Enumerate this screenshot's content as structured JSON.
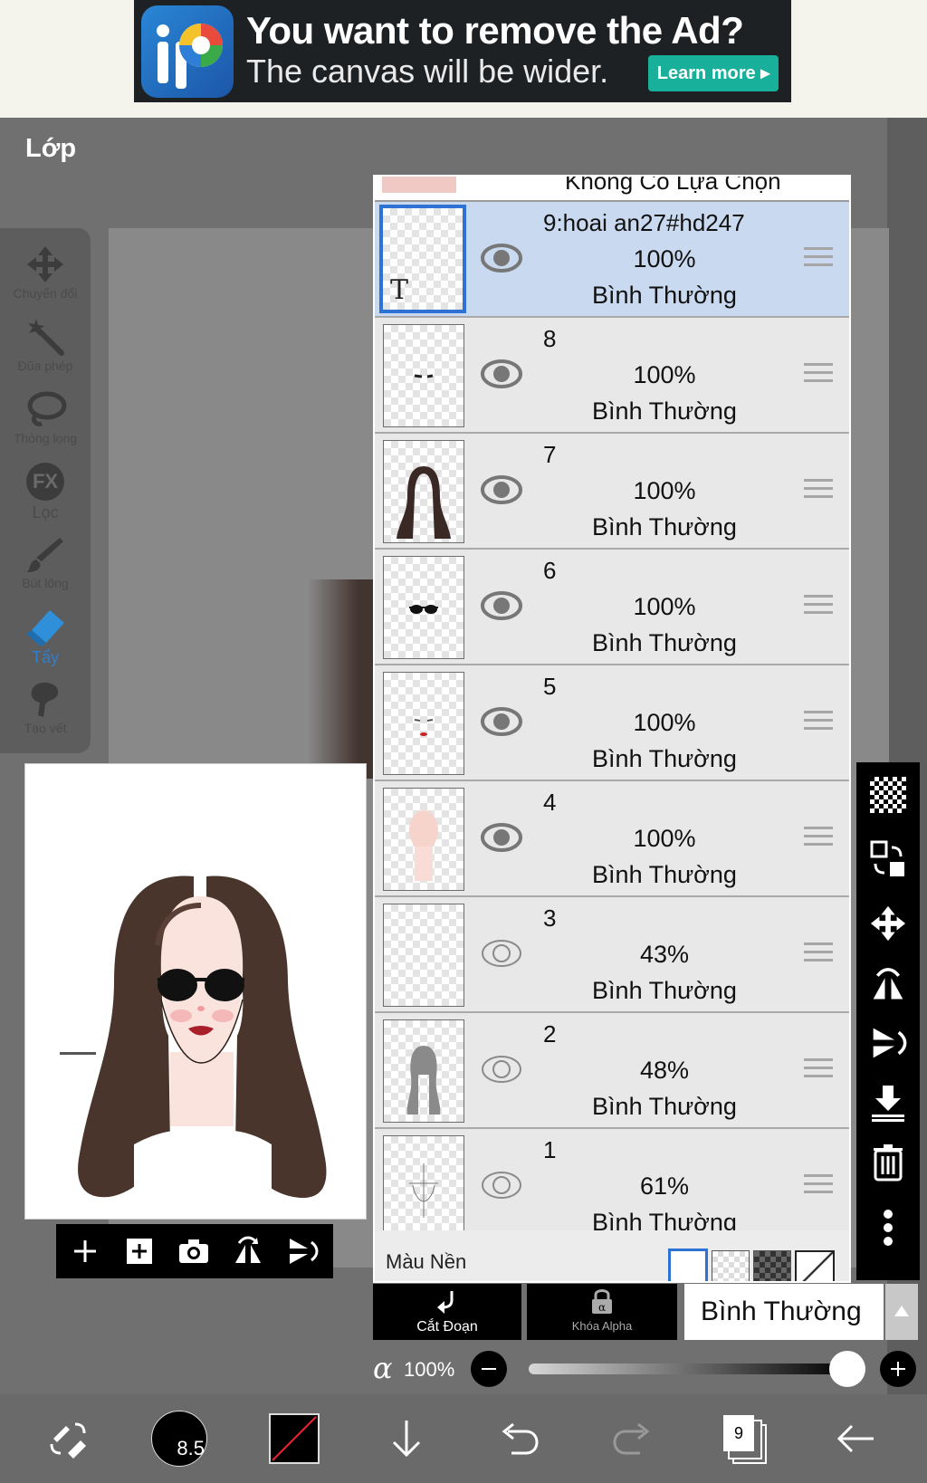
{
  "ad": {
    "title": "You want to remove the Ad?",
    "subtitle": "The canvas will be wider.",
    "learn_more": "Learn more ▸",
    "logo_letters": "iP"
  },
  "dialog": {
    "title": "Lớp"
  },
  "tools": [
    {
      "label": "Chuyển đổi",
      "icon": "move-icon"
    },
    {
      "label": "Đũa phép",
      "icon": "magic-wand-icon"
    },
    {
      "label": "Thòng lọng",
      "icon": "lasso-icon"
    },
    {
      "label": "Lọc",
      "icon": "fx-icon",
      "icon_text": "FX"
    },
    {
      "label": "Bút lông",
      "icon": "brush-icon"
    },
    {
      "label": "Tẩy",
      "icon": "eraser-icon",
      "active": true
    },
    {
      "label": "Tạo vết",
      "icon": "smudge-icon"
    }
  ],
  "layers": {
    "no_selection": "Không Có Lựa Chọn",
    "items": [
      {
        "name": "9:hoai an27#hd247",
        "opacity": "100%",
        "mode": "Bình Thường",
        "visible": true,
        "selected": true,
        "text_marker": "T"
      },
      {
        "name": "8",
        "opacity": "100%",
        "mode": "Bình Thường",
        "visible": true
      },
      {
        "name": "7",
        "opacity": "100%",
        "mode": "Bình Thường",
        "visible": true
      },
      {
        "name": "6",
        "opacity": "100%",
        "mode": "Bình Thường",
        "visible": true
      },
      {
        "name": "5",
        "opacity": "100%",
        "mode": "Bình Thường",
        "visible": true
      },
      {
        "name": "4",
        "opacity": "100%",
        "mode": "Bình Thường",
        "visible": true
      },
      {
        "name": "3",
        "opacity": "43%",
        "mode": "Bình Thường",
        "visible": false
      },
      {
        "name": "2",
        "opacity": "48%",
        "mode": "Bình Thường",
        "visible": false
      },
      {
        "name": "1",
        "opacity": "61%",
        "mode": "Bình Thường",
        "visible": false
      }
    ],
    "background_label": "Màu Nền"
  },
  "controls": {
    "clipping_label": "Cắt Đoạn",
    "alpha_lock_label": "Khóa Alpha",
    "blend_mode": "Bình Thường",
    "alpha_symbol": "α",
    "opacity": "100%",
    "opacity_fraction": 1.0
  },
  "brush_size": "8.5",
  "layer_count": "9",
  "colors": {
    "selected_row": "#c9d9ef",
    "selection_border": "#2e73d4",
    "ad_button": "#18b09a",
    "primary_color": "#000000"
  }
}
